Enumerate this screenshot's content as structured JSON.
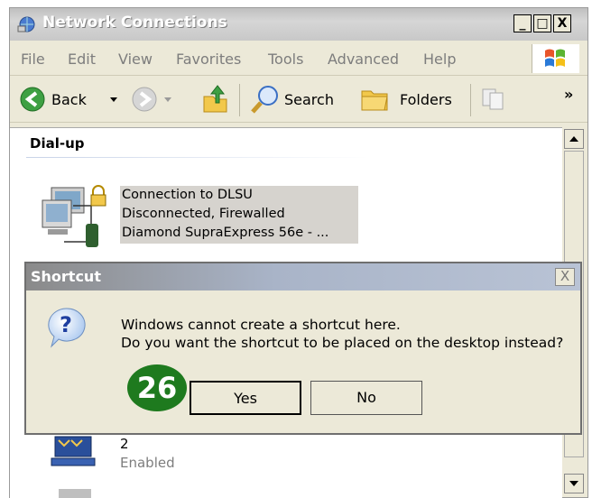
{
  "window": {
    "title": "Network Connections",
    "caption_buttons": [
      "_",
      "□",
      "X"
    ]
  },
  "menubar": {
    "items": [
      "File",
      "Edit",
      "View",
      "Favorites",
      "Tools",
      "Advanced",
      "Help"
    ]
  },
  "toolbar": {
    "back_label": "Back",
    "search_label": "Search",
    "folders_label": "Folders",
    "more_glyph": "»"
  },
  "content": {
    "group_title": "Dial-up",
    "connection": {
      "name": "Connection to DLSU",
      "status": "Disconnected, Firewalled",
      "device": "Diamond SupraExpress 56e - ..."
    },
    "item2": {
      "name": "2",
      "status": "Enabled"
    }
  },
  "dialog": {
    "title": "Shortcut",
    "close_glyph": "X",
    "message_line1": "Windows cannot create a shortcut here.",
    "message_line2": "Do you want the shortcut to be placed on the desktop instead?",
    "yes_label": "Yes",
    "no_label": "No"
  },
  "step_badge": "26",
  "colors": {
    "xp_face": "#ECE9D8",
    "badge_green": "#1e7a1e",
    "title_gray": "#bfbfbf"
  }
}
